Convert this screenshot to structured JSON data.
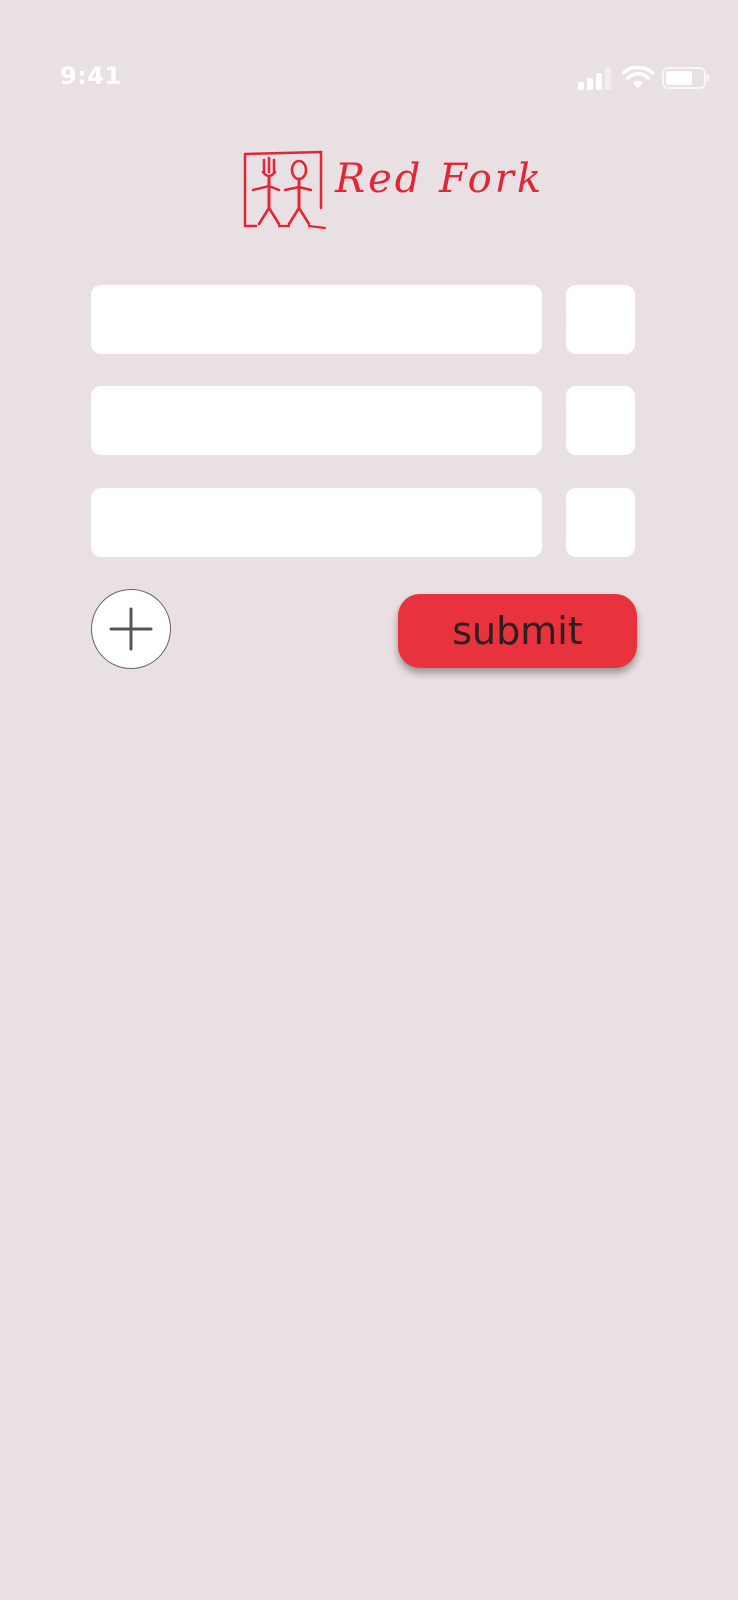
{
  "status_bar": {
    "time": "9:41",
    "signal_icon": "cellular-signal-icon",
    "wifi_icon": "wifi-icon",
    "battery_icon": "battery-icon"
  },
  "logo": {
    "text": "Red Fork",
    "icon": "fork-and-spoon-logo-icon",
    "color": "#e32636"
  },
  "form": {
    "rows": [
      {
        "item_value": "",
        "qty_value": ""
      },
      {
        "item_value": "",
        "qty_value": ""
      },
      {
        "item_value": "",
        "qty_value": ""
      }
    ],
    "add_icon": "plus-icon",
    "submit_label": "submit"
  },
  "colors": {
    "background": "#e8e0e2",
    "accent": "#e8323e",
    "field": "#ffffff"
  }
}
